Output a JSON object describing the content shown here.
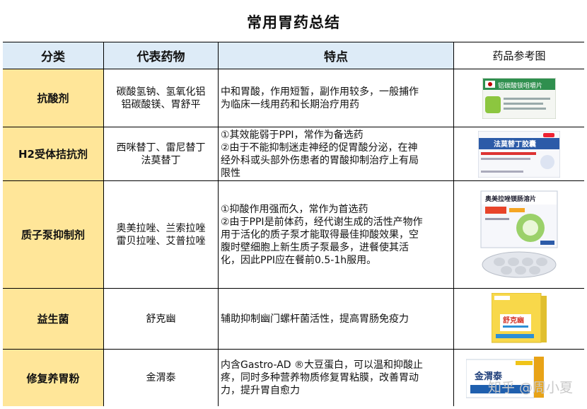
{
  "title": "常用胃药总结",
  "headers": [
    "分类",
    "代表药物",
    "特点",
    "药品参考图"
  ],
  "rows": [
    {
      "category": "抗酸剂",
      "drugs": [
        "碳酸氢钠、氢氧化铝",
        "铝碳酸镁、胃舒平"
      ],
      "features": [
        "中和胃酸，作用短暂，副作用较多，一般捕作",
        "为临床一线用药和长期治疗用药"
      ],
      "box_text": "铝碳酸镁咀嚼片"
    },
    {
      "category": "H2受体拮抗剂",
      "drugs": [
        "西咪替丁、雷尼替丁",
        "法莫替丁"
      ],
      "features": [
        "①其效能弱于PPI，常作为备选药",
        "②由于不能抑制迷走神经的促胃酸分泌，在神",
        "经外科或头部外伤患者的胃酸抑制治疗上有局",
        "限性"
      ],
      "box_text": "法莫替丁胶囊"
    },
    {
      "category": "质子泵抑制剂",
      "drugs": [
        "奥美拉唑、兰索拉唑",
        "雷贝拉唑、艾普拉唑"
      ],
      "features": [
        "①抑酸作用强而久，常作为首选药",
        "②由于PPI是前体药，经代谢生成的活性产物作",
        "用于活化的质子泵才能取得最佳抑酸效果，空",
        "腹时壁细胞上新生质子泵最多，进餐使其活",
        "化，因此PPI应在餐前0.5-1h服用。"
      ],
      "box_text": "奥美拉唑镁肠溶片"
    },
    {
      "category": "益生菌",
      "drugs": [
        "舒克幽"
      ],
      "features": [
        "辅助抑制幽门螺杆菌活性，提高胃肠免疫力"
      ],
      "box_text": "舒克幽"
    },
    {
      "category": "修复养胃粉",
      "drugs": [
        "金渭泰"
      ],
      "features": [
        "内含Gastro-AD ®大豆蛋白，可以温和抑酸止",
        "疼，同时多种营养物质修复胃粘膜，改善胃动",
        "力，提升胃自愈力"
      ],
      "box_text": "金渭泰"
    }
  ],
  "watermark": "知乎 @周小夏",
  "colors": {
    "header_bg": "#ddebf7",
    "category_bg": "#ffe699"
  }
}
